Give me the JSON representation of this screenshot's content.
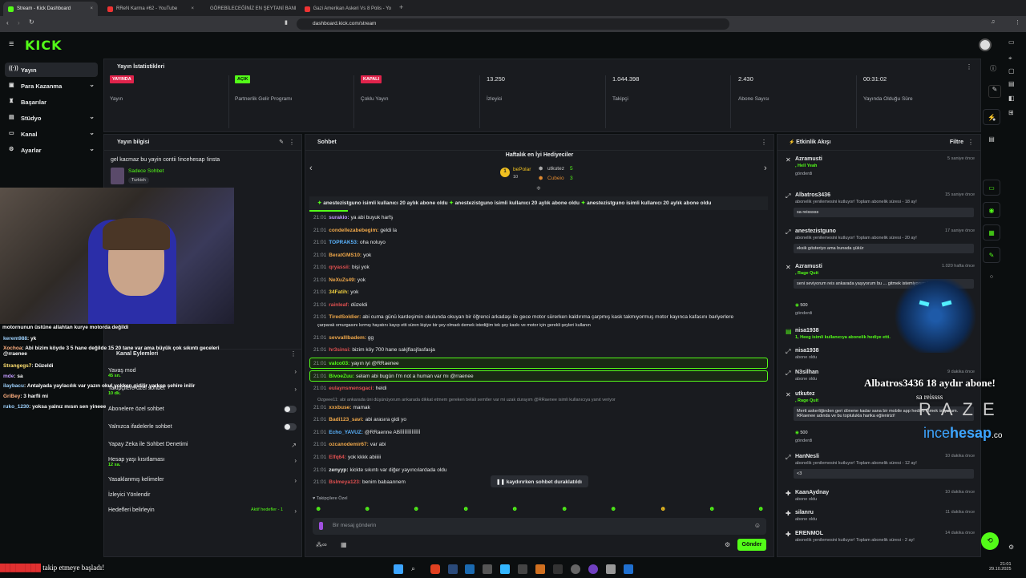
{
  "browser": {
    "tabs": [
      {
        "title": "Stream - Kick Dashboard"
      },
      {
        "title": "RReN Karma #62 - YouTube"
      },
      {
        "title": "GÖREBİLECEĞİNİZ EN ŞEYTANİ BANI"
      },
      {
        "title": "Gazi Amerikan Askeri Vs 8 Polis - Yo"
      }
    ],
    "url": "dashboard.kick.com/stream"
  },
  "brand": {
    "logo": "KICK",
    "accent": "#53fc18"
  },
  "sidebar": {
    "items": [
      {
        "label": "Yayın",
        "icon": "broadcast-icon"
      },
      {
        "label": "Para Kazanma",
        "icon": "money-icon"
      },
      {
        "label": "Başarılar",
        "icon": "trophy-icon"
      },
      {
        "label": "Stüdyo",
        "icon": "studio-icon"
      },
      {
        "label": "Kanal",
        "icon": "channel-icon"
      },
      {
        "label": "Ayarlar",
        "icon": "gear-icon"
      }
    ]
  },
  "stats": {
    "title": "Yayın İstatistikleri",
    "cards": [
      {
        "badge": "YAYINDA",
        "label": "Yayın"
      },
      {
        "badge": "AÇIK",
        "label": "Partnerlik Gelir Programı"
      },
      {
        "badge": "KAPALI",
        "label": "Çoklu Yayın"
      },
      {
        "value": "13.250",
        "label": "İzleyici"
      },
      {
        "value": "1.044.398",
        "label": "Takipçi"
      },
      {
        "value": "2.430",
        "label": "Abone Sayısı"
      },
      {
        "value": "00:31:02",
        "label": "Yayında Olduğu Süre"
      }
    ]
  },
  "stream_info": {
    "title": "Yayın bilgisi",
    "stream_title": "gel kacmaz bu yayin contii !incehesap !insta",
    "category": "Sadece Sohbet",
    "tag": "Turkish"
  },
  "chat_actions": {
    "title": "Kanal Eylemleri",
    "rows": [
      {
        "label": "Yavaş mod",
        "sub": "45 sn."
      },
      {
        "label": "Takipçilere özel sohbet",
        "sub": "10 dk."
      },
      {
        "label": "Abonelere özel sohbet"
      },
      {
        "label": "Yalnızca ifadelerle sohbet"
      },
      {
        "label": "Yapay Zeka ile Sohbet Denetimi"
      },
      {
        "label": "Hesap yaşı kısıtlaması",
        "sub": "12 sa."
      },
      {
        "label": "Yasaklanmış kelimeler"
      },
      {
        "label": "İzleyici Yönlendir"
      },
      {
        "label": "Hedefleri belirleyin",
        "extra": "Aktif hedefler - 1"
      }
    ]
  },
  "chat": {
    "title": "Sohbet",
    "gifters_title": "Haftalık en İyi Hediyeciler",
    "gifters": [
      {
        "name": "bePolar",
        "count": "10"
      },
      {
        "name": "utkutez",
        "count": "5"
      },
      {
        "name": "Cubeio",
        "count": "3"
      }
    ],
    "ticker": "anestezistguno isimli kullanıcı 20 aylık abone oldu",
    "messages": [
      {
        "time": "21:01",
        "user": "surakio:",
        "text": "ya abi buyuk harfş",
        "color": "#c39bff"
      },
      {
        "time": "21:01",
        "user": "condellezabebegim:",
        "text": "geldi la",
        "color": "#f0a84a"
      },
      {
        "time": "21:01",
        "user": "TOPRAK53:",
        "text": "oha noluyo",
        "color": "#5ab4ff"
      },
      {
        "time": "21:01",
        "user": "BeratGMS10:",
        "text": "yok",
        "color": "#f0a84a"
      },
      {
        "time": "21:01",
        "user": "qryassii:",
        "text": "bişi yok",
        "color": "#e05050"
      },
      {
        "time": "21:01",
        "user": "NeXuZs49:",
        "text": "yok",
        "color": "#f0a84a"
      },
      {
        "time": "21:01",
        "user": "34Fatih:",
        "text": "yok",
        "color": "#f0d040"
      },
      {
        "time": "21:01",
        "user": "rainleaf:",
        "text": "düzeldi",
        "color": "#e05050"
      },
      {
        "time": "21:01",
        "user": "TiredSoldier:",
        "text": "abi cuma günü kardeşimin okulunda okuyan bir öğrenci arkadaşı ile gece motor sürerken kaldırıma çarpmış kask takmıyormuş motor kayınca kafasını bariyerlere",
        "color": "#f0a84a"
      },
      {
        "time": "",
        "user": "",
        "text": "çarparak omurgasını kırmış hayatını kayıp etti süren kişiye bir şey olmadı demek istediğim tek şey kaskı ve motor için gerekli şeyleri kullanın",
        "color": "#e7e9ea"
      },
      {
        "time": "21:01",
        "user": "sevvalllbadem:",
        "text": "gg",
        "color": "#f0a84a"
      },
      {
        "time": "21:01",
        "user": "hr3sinsi:",
        "text": "bizim köy 700 hane sakjflasjfasfasja",
        "color": "#e05050"
      },
      {
        "time": "21:01",
        "user": "valco03:",
        "text": "yayın iyi @RRaenee",
        "color": "#53fc18",
        "highlight": true
      },
      {
        "time": "21:01",
        "user": "BivoeZuu:",
        "text": "selam abi bugün I'm not a human var mı @rraenee",
        "color": "#53fc18",
        "highlight": true
      },
      {
        "time": "21:01",
        "user": "eulaynsmensgaci:",
        "text": "heldi",
        "color": "#e05050"
      },
      {
        "time": "",
        "user": "",
        "text": "Ozgeee11: abi ankarada üni düşünüyorum ankarada dikkat etmem gereken belali semtler var mi uzak durayım @RRaenee isimli kullanıcıya yanıt veriyor",
        "color": "#8f9499"
      },
      {
        "time": "21:01",
        "user": "xxxbuse:",
        "text": "mamak",
        "color": "#f0a84a"
      },
      {
        "time": "21:01",
        "user": "Badi123_savi:",
        "text": "abi arasıra gidi yo",
        "color": "#f0a84a"
      },
      {
        "time": "21:01",
        "user": "Echo_YAVUZ:",
        "text": "@RRaenne ABİİİİİİİİİİİİİİ",
        "color": "#5ab4ff"
      },
      {
        "time": "21:01",
        "user": "ozcanodemir67:",
        "text": "var abi",
        "color": "#f0a84a"
      },
      {
        "time": "21:01",
        "user": "Elfq64:",
        "text": "yok kkkk abiiiii",
        "color": "#e05050"
      },
      {
        "time": "21:01",
        "user": "zenyyp:",
        "text": "kickte sıkıntı var diğer yayıncılardada oldu",
        "color": "#e7e9ea"
      },
      {
        "time": "21:01",
        "user": "Bslmeya123:",
        "text": "benim babaannem",
        "color": "#e05050"
      }
    ],
    "paused_label": "kaydırırken sohbet duraklatıldı",
    "follower_only_label": "Takipçilere Özel",
    "input_placeholder": "Bir mesaj gönderin",
    "send_label": "Gönder"
  },
  "activity": {
    "title": "Etkinlik Akışı",
    "filter_label": "Filtre",
    "events": [
      {
        "user": "Azramusti",
        "time": "5 saniye önce",
        "line": ", Hell Yeah",
        "sub": "gönderdi"
      },
      {
        "user": "Albatros3436",
        "time": "15 saniye önce",
        "line": "abonelik yenilemesini kutluyor! Toplam abonelik süresi - 18 ay!",
        "box": "sa reisssss"
      },
      {
        "user": "anestezistguno",
        "time": "17 saniye önce",
        "line": "abonelik yenilemesini kutluyor! Toplam abonelik süresi - 20 ay!",
        "box": "eksik gösteriyo ama bunada şükür"
      },
      {
        "user": "Azramusti",
        "time": "1.020 hafta önce",
        "line": ", Rage Quit",
        "box": "seni seviyorum reis ankarada yaşıyorum bu ... gitmek istemiyorum isterim",
        "amount": "500",
        "sub": "gönderdi"
      },
      {
        "user": "nisa1938",
        "time": "",
        "line": "1, Heeg isimli kullanıcıya abonelik hediye etti."
      },
      {
        "user": "nisa1938",
        "time": "",
        "line": "abone oldu"
      },
      {
        "user": "N3silhan",
        "time": "9 dakika önce",
        "line": "abone oldu"
      },
      {
        "user": "utkutez",
        "time": "",
        "line": ", Rage Quit",
        "box": "Mertt askerliğinden geri dönene kadar sana bir mobile app hediye etmek istiyorum. RRaenee adında ve bu topluluklа harika eğlenirizi!",
        "amount": "500",
        "sub": "gönderdi"
      },
      {
        "user": "HanNesli",
        "time": "10 dakika önce",
        "line": "abonelik yenilemesini kutluyor! Toplam abonelik süresi - 12 ay!",
        "box": "<3"
      },
      {
        "user": "KaanAydnay",
        "time": "10 dakika önce",
        "line": "abone oldu"
      },
      {
        "user": "silanru",
        "time": "11 dakika önce",
        "line": "abone oldu"
      },
      {
        "user": "ERENMOL",
        "time": "14 dakika önce",
        "line": "abonelik yenilemesini kutluyor! Toplam abonelik süresi - 2 ay!"
      }
    ]
  },
  "overlay": {
    "headline": "motornunun üstüne allahtan kurye motorda değildi",
    "chat": [
      {
        "user": "kerem988",
        "text": ": yk"
      },
      {
        "user": "Xochoa",
        "text": ": Abi bizim köyde 3 5 hane değilde 15 20 tane var ama büyük çok sıkıntı geceleri @rraenee"
      },
      {
        "user": "Strangegs7",
        "text": ": Düzeldi"
      },
      {
        "user": "mde",
        "text": ": sa"
      },
      {
        "user": "ilaybacu",
        "text": ": Antalyada yaylacılık var yazın okul yokken gidilir yarken şehire inilir"
      },
      {
        "user": "GriBey",
        "text": ": 3 harfli mi"
      },
      {
        "user": "ruko_1230",
        "text": ": yoksa yalnız mısın sen yineee"
      }
    ],
    "alert_title": "Albatros3436  18  aydır abone!",
    "alert_sub": "sa reissss",
    "sponsor_brand": "RAZER",
    "sponsor_site_a": "ince",
    "sponsor_site_b": "hesap",
    "sponsor_site_c": ".com",
    "bottom_follow": "takip etmeye başladı!"
  },
  "taskbar": {
    "time": "21:01",
    "date": "29.10.2025"
  }
}
